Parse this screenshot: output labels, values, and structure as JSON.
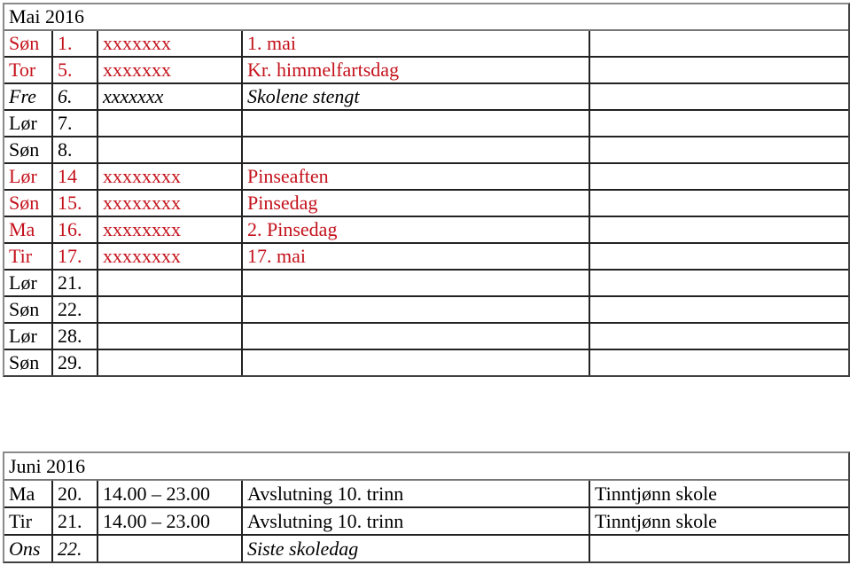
{
  "colors": {
    "holiday": "#c4121c",
    "text": "#000000"
  },
  "mai": {
    "title": "Mai 2016",
    "rows": [
      {
        "day": "Søn",
        "date": "1.",
        "time": "xxxxxxx",
        "event": "1. mai",
        "style": "red"
      },
      {
        "day": "Tor",
        "date": "5.",
        "time": "xxxxxxx",
        "event": "Kr. himmelfartsdag",
        "style": "red"
      },
      {
        "day": "Fre",
        "date": "6.",
        "time": "xxxxxxx",
        "event": "Skolene stengt",
        "style": "ital"
      },
      {
        "day": "Lør",
        "date": "7.",
        "time": "",
        "event": "",
        "style": ""
      },
      {
        "day": "Søn",
        "date": "8.",
        "time": "",
        "event": "",
        "style": ""
      },
      {
        "day": "Lør",
        "date": "14",
        "time": "xxxxxxxx",
        "event": "Pinseaften",
        "style": "red"
      },
      {
        "day": "Søn",
        "date": "15.",
        "time": "xxxxxxxx",
        "event": "Pinsedag",
        "style": "red"
      },
      {
        "day": "Ma",
        "date": "16.",
        "time": "xxxxxxxx",
        "event": "2. Pinsedag",
        "style": "red"
      },
      {
        "day": "Tir",
        "date": "17.",
        "time": "xxxxxxxx",
        "event": "17. mai",
        "style": "red"
      },
      {
        "day": "Lør",
        "date": "21.",
        "time": "",
        "event": "",
        "style": ""
      },
      {
        "day": "Søn",
        "date": "22.",
        "time": "",
        "event": "",
        "style": ""
      },
      {
        "day": "Lør",
        "date": "28.",
        "time": "",
        "event": "",
        "style": ""
      },
      {
        "day": "Søn",
        "date": "29.",
        "time": "",
        "event": "",
        "style": ""
      }
    ]
  },
  "juni": {
    "title": "Juni 2016",
    "rows": [
      {
        "day": "Ma",
        "date": "20.",
        "time": "14.00 – 23.00",
        "event": "Avslutning 10. trinn",
        "place": "Tinntjønn skole",
        "style": ""
      },
      {
        "day": "Tir",
        "date": "21.",
        "time": "14.00 – 23.00",
        "event": "Avslutning 10. trinn",
        "place": "Tinntjønn skole",
        "style": ""
      },
      {
        "day": "Ons",
        "date": "22.",
        "time": "",
        "event": "Siste skoledag",
        "place": "",
        "style": "ital"
      }
    ]
  }
}
